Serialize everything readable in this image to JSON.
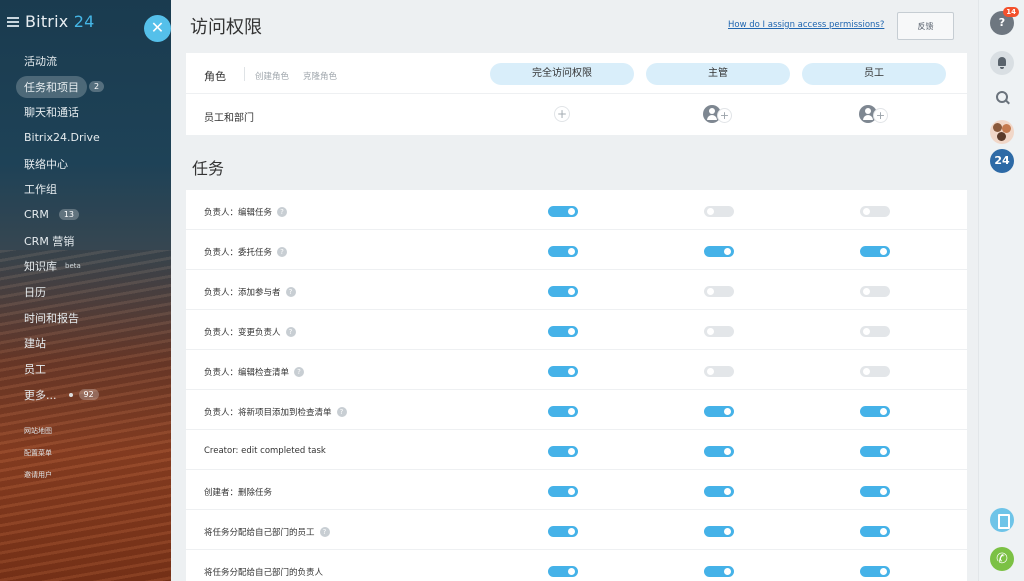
{
  "sidebar": {
    "logo_word": "Bitrix",
    "logo_num": "24",
    "items": [
      {
        "label": "活动流"
      },
      {
        "label": "任务和项目",
        "badge": "2",
        "active": true
      },
      {
        "label": "聊天和通话"
      },
      {
        "label": "Bitrix24.Drive"
      },
      {
        "label": "联络中心"
      },
      {
        "label": "工作组"
      },
      {
        "label": "CRM",
        "badge": "13"
      },
      {
        "label": "CRM 营销"
      },
      {
        "label": "知识库",
        "sup": "beta"
      },
      {
        "label": "日历"
      },
      {
        "label": "时间和报告"
      },
      {
        "label": "建站"
      },
      {
        "label": "员工"
      },
      {
        "label": "更多...",
        "badge": "92"
      }
    ],
    "small_links": [
      "网站地图",
      "配置菜单",
      "邀请用户"
    ]
  },
  "header": {
    "title": "访问权限",
    "help_link": "How do I assign access permissions?",
    "feedback": "反馈"
  },
  "roles": {
    "title": "角色",
    "create": "创建角色",
    "clone": "克隆角色",
    "columns": [
      "完全访问权限",
      "主管",
      "员工"
    ],
    "staff_label": "员工和部门"
  },
  "section_title": "任务",
  "permissions": [
    {
      "label": "负责人：编辑任务",
      "help": true,
      "values": [
        true,
        false,
        false
      ]
    },
    {
      "label": "负责人：委托任务",
      "help": true,
      "values": [
        true,
        true,
        true
      ]
    },
    {
      "label": "负责人：添加参与者",
      "help": true,
      "values": [
        true,
        false,
        false
      ]
    },
    {
      "label": "负责人：变更负责人",
      "help": true,
      "values": [
        true,
        false,
        false
      ]
    },
    {
      "label": "负责人：编辑检查清单",
      "help": true,
      "values": [
        true,
        false,
        false
      ]
    },
    {
      "label": "负责人：将新项目添加到检查清单",
      "help": true,
      "values": [
        true,
        true,
        true
      ]
    },
    {
      "label": "Creator: edit completed task",
      "help": false,
      "values": [
        true,
        true,
        true
      ]
    },
    {
      "label": "创建者：删除任务",
      "help": false,
      "values": [
        true,
        true,
        true
      ]
    },
    {
      "label": "将任务分配给自己部门的员工",
      "help": true,
      "values": [
        true,
        true,
        true
      ]
    },
    {
      "label": "将任务分配给自己部门的负责人",
      "help": false,
      "values": [
        true,
        true,
        true
      ]
    }
  ],
  "rightbar": {
    "help_mark": "?",
    "help_count": "14",
    "bitrix_badge": "24"
  },
  "icons": {
    "close": "close-icon",
    "help": "question-icon",
    "bell": "bell-icon",
    "search": "search-icon",
    "phone": "phone-icon"
  },
  "colors": {
    "accent": "#45b2e8",
    "pill": "#d9eefa",
    "notification": "#f3512c",
    "phone": "#7bc144"
  }
}
